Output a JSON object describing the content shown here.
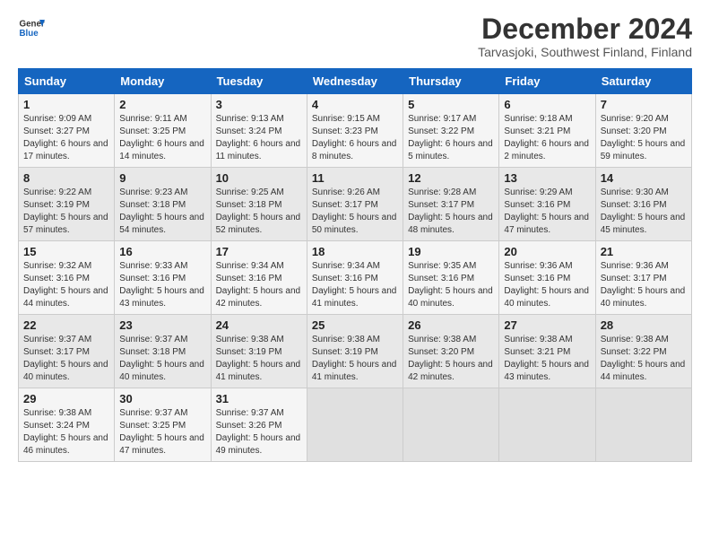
{
  "header": {
    "logo_line1": "General",
    "logo_line2": "Blue",
    "title": "December 2024",
    "subtitle": "Tarvasjoki, Southwest Finland, Finland"
  },
  "columns": [
    "Sunday",
    "Monday",
    "Tuesday",
    "Wednesday",
    "Thursday",
    "Friday",
    "Saturday"
  ],
  "weeks": [
    [
      {
        "day": "1",
        "info": "Sunrise: 9:09 AM\nSunset: 3:27 PM\nDaylight: 6 hours and 17 minutes."
      },
      {
        "day": "2",
        "info": "Sunrise: 9:11 AM\nSunset: 3:25 PM\nDaylight: 6 hours and 14 minutes."
      },
      {
        "day": "3",
        "info": "Sunrise: 9:13 AM\nSunset: 3:24 PM\nDaylight: 6 hours and 11 minutes."
      },
      {
        "day": "4",
        "info": "Sunrise: 9:15 AM\nSunset: 3:23 PM\nDaylight: 6 hours and 8 minutes."
      },
      {
        "day": "5",
        "info": "Sunrise: 9:17 AM\nSunset: 3:22 PM\nDaylight: 6 hours and 5 minutes."
      },
      {
        "day": "6",
        "info": "Sunrise: 9:18 AM\nSunset: 3:21 PM\nDaylight: 6 hours and 2 minutes."
      },
      {
        "day": "7",
        "info": "Sunrise: 9:20 AM\nSunset: 3:20 PM\nDaylight: 5 hours and 59 minutes."
      }
    ],
    [
      {
        "day": "8",
        "info": "Sunrise: 9:22 AM\nSunset: 3:19 PM\nDaylight: 5 hours and 57 minutes."
      },
      {
        "day": "9",
        "info": "Sunrise: 9:23 AM\nSunset: 3:18 PM\nDaylight: 5 hours and 54 minutes."
      },
      {
        "day": "10",
        "info": "Sunrise: 9:25 AM\nSunset: 3:18 PM\nDaylight: 5 hours and 52 minutes."
      },
      {
        "day": "11",
        "info": "Sunrise: 9:26 AM\nSunset: 3:17 PM\nDaylight: 5 hours and 50 minutes."
      },
      {
        "day": "12",
        "info": "Sunrise: 9:28 AM\nSunset: 3:17 PM\nDaylight: 5 hours and 48 minutes."
      },
      {
        "day": "13",
        "info": "Sunrise: 9:29 AM\nSunset: 3:16 PM\nDaylight: 5 hours and 47 minutes."
      },
      {
        "day": "14",
        "info": "Sunrise: 9:30 AM\nSunset: 3:16 PM\nDaylight: 5 hours and 45 minutes."
      }
    ],
    [
      {
        "day": "15",
        "info": "Sunrise: 9:32 AM\nSunset: 3:16 PM\nDaylight: 5 hours and 44 minutes."
      },
      {
        "day": "16",
        "info": "Sunrise: 9:33 AM\nSunset: 3:16 PM\nDaylight: 5 hours and 43 minutes."
      },
      {
        "day": "17",
        "info": "Sunrise: 9:34 AM\nSunset: 3:16 PM\nDaylight: 5 hours and 42 minutes."
      },
      {
        "day": "18",
        "info": "Sunrise: 9:34 AM\nSunset: 3:16 PM\nDaylight: 5 hours and 41 minutes."
      },
      {
        "day": "19",
        "info": "Sunrise: 9:35 AM\nSunset: 3:16 PM\nDaylight: 5 hours and 40 minutes."
      },
      {
        "day": "20",
        "info": "Sunrise: 9:36 AM\nSunset: 3:16 PM\nDaylight: 5 hours and 40 minutes."
      },
      {
        "day": "21",
        "info": "Sunrise: 9:36 AM\nSunset: 3:17 PM\nDaylight: 5 hours and 40 minutes."
      }
    ],
    [
      {
        "day": "22",
        "info": "Sunrise: 9:37 AM\nSunset: 3:17 PM\nDaylight: 5 hours and 40 minutes."
      },
      {
        "day": "23",
        "info": "Sunrise: 9:37 AM\nSunset: 3:18 PM\nDaylight: 5 hours and 40 minutes."
      },
      {
        "day": "24",
        "info": "Sunrise: 9:38 AM\nSunset: 3:19 PM\nDaylight: 5 hours and 41 minutes."
      },
      {
        "day": "25",
        "info": "Sunrise: 9:38 AM\nSunset: 3:19 PM\nDaylight: 5 hours and 41 minutes."
      },
      {
        "day": "26",
        "info": "Sunrise: 9:38 AM\nSunset: 3:20 PM\nDaylight: 5 hours and 42 minutes."
      },
      {
        "day": "27",
        "info": "Sunrise: 9:38 AM\nSunset: 3:21 PM\nDaylight: 5 hours and 43 minutes."
      },
      {
        "day": "28",
        "info": "Sunrise: 9:38 AM\nSunset: 3:22 PM\nDaylight: 5 hours and 44 minutes."
      }
    ],
    [
      {
        "day": "29",
        "info": "Sunrise: 9:38 AM\nSunset: 3:24 PM\nDaylight: 5 hours and 46 minutes."
      },
      {
        "day": "30",
        "info": "Sunrise: 9:37 AM\nSunset: 3:25 PM\nDaylight: 5 hours and 47 minutes."
      },
      {
        "day": "31",
        "info": "Sunrise: 9:37 AM\nSunset: 3:26 PM\nDaylight: 5 hours and 49 minutes."
      },
      null,
      null,
      null,
      null
    ]
  ]
}
